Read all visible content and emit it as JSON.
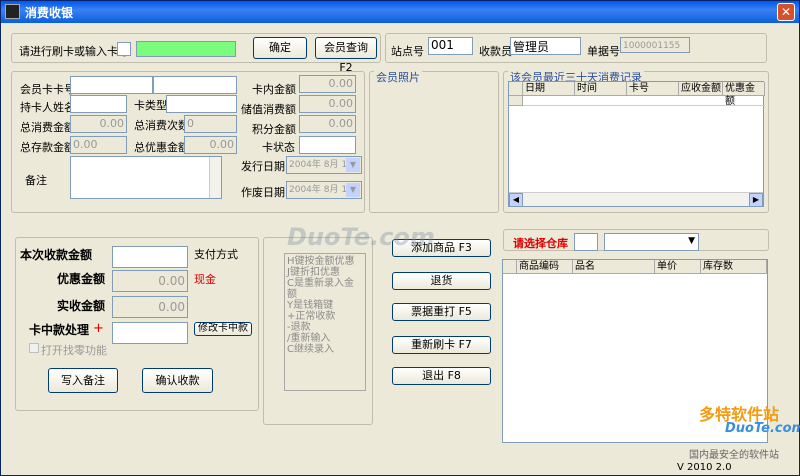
{
  "window": {
    "title": "消费收银",
    "close": "✕",
    "version": "V 2010 2.0"
  },
  "top": {
    "prompt": "请进行刷卡或输入卡号",
    "confirm": "确定",
    "member_query": "会员查询 F2",
    "station_label": "站点号",
    "station_value": "001",
    "cashier_label": "收款员",
    "cashier_value": "管理员",
    "doc_label": "单据号",
    "doc_value": "1000001155"
  },
  "member": {
    "card_no_label": "会员卡卡号",
    "holder_label": "持卡人姓名",
    "card_type_label": "卡类型",
    "total_consume_label": "总消费金额",
    "total_consume_value": "0.00",
    "consume_count_label": "总消费次数",
    "consume_count_value": "0",
    "total_deposit_label": "总存款金额",
    "total_deposit_value": "0.00",
    "total_discount_label": "总优惠金额",
    "total_discount_value": "0.00",
    "card_balance_label": "卡内金额",
    "card_balance_value": "0.00",
    "stored_consume_label": "储值消费额",
    "stored_consume_value": "0.00",
    "points_label": "积分金额",
    "points_value": "0.00",
    "card_status_label": "卡状态",
    "issue_date_label": "发行日期",
    "issue_date_value": "2004年 8月 19",
    "void_date_label": "作废日期",
    "void_date_value": "2004年 8月 19",
    "remark_label": "备注"
  },
  "photo": {
    "label": "会员照片"
  },
  "history": {
    "label": "该会员最近三十天消费记录",
    "columns": [
      "日期",
      "时间",
      "卡号",
      "应收金额",
      "优惠金额"
    ]
  },
  "pay": {
    "amount_label": "本次收款金额",
    "method_label": "支付方式",
    "discount_label": "优惠金额",
    "discount_value": "0.00",
    "method_value": "现金",
    "received_label": "实收金额",
    "received_value": "0.00",
    "card_mid_label": "卡中款处理",
    "plus": "+",
    "modify_card": "修改卡中款",
    "open_change": "打开找零功能",
    "write_remark": "写入备注",
    "confirm_receive": "确认收款"
  },
  "hints": [
    "H键按金额优惠",
    "J键折扣优惠",
    "C是重新录入金额",
    "Y是钱箱键",
    "+正常收款",
    "-退款",
    "/重新输入",
    "C继续录入"
  ],
  "actions": {
    "add_item": "添加商品 F3",
    "return": "退货",
    "reprint": "票据重打 F5",
    "reswipe": "重新刷卡 F7",
    "exit": "退出 F8"
  },
  "warehouse": {
    "label": "请选择仓库",
    "columns": [
      "商品编码",
      "品名",
      "单价",
      "库存数"
    ]
  },
  "watermark": {
    "site": "DuoTe.com",
    "brand": "多特软件站",
    "slogan": "国内最安全的软件站"
  }
}
